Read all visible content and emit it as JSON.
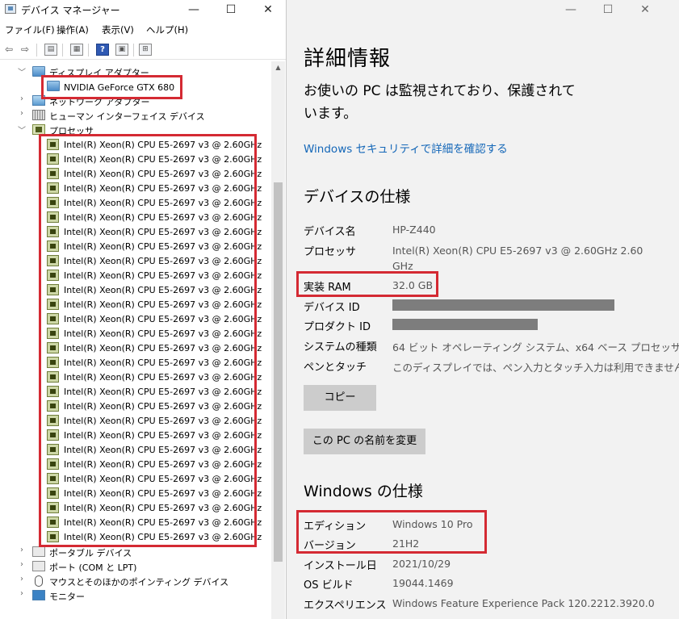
{
  "device_manager": {
    "title": "デバイス マネージャー",
    "window_controls": {
      "minimize": "—",
      "maximize": "☐",
      "close": "✕"
    },
    "menu": [
      "ファイル(F)",
      "操作(A)",
      "表示(V)",
      "ヘルプ(H)"
    ],
    "toolbar_help": "?",
    "tree": {
      "display_adapters": {
        "label": "ディスプレイ アダプター",
        "items": [
          "NVIDIA GeForce GTX 680"
        ]
      },
      "network_adapters": "ネットワーク アダプター",
      "hid": "ヒューマン インターフェイス デバイス",
      "processors": {
        "label": "プロセッサ",
        "items": [
          "Intel(R) Xeon(R) CPU E5-2697 v3 @ 2.60GHz",
          "Intel(R) Xeon(R) CPU E5-2697 v3 @ 2.60GHz",
          "Intel(R) Xeon(R) CPU E5-2697 v3 @ 2.60GHz",
          "Intel(R) Xeon(R) CPU E5-2697 v3 @ 2.60GHz",
          "Intel(R) Xeon(R) CPU E5-2697 v3 @ 2.60GHz",
          "Intel(R) Xeon(R) CPU E5-2697 v3 @ 2.60GHz",
          "Intel(R) Xeon(R) CPU E5-2697 v3 @ 2.60GHz",
          "Intel(R) Xeon(R) CPU E5-2697 v3 @ 2.60GHz",
          "Intel(R) Xeon(R) CPU E5-2697 v3 @ 2.60GHz",
          "Intel(R) Xeon(R) CPU E5-2697 v3 @ 2.60GHz",
          "Intel(R) Xeon(R) CPU E5-2697 v3 @ 2.60GHz",
          "Intel(R) Xeon(R) CPU E5-2697 v3 @ 2.60GHz",
          "Intel(R) Xeon(R) CPU E5-2697 v3 @ 2.60GHz",
          "Intel(R) Xeon(R) CPU E5-2697 v3 @ 2.60GHz",
          "Intel(R) Xeon(R) CPU E5-2697 v3 @ 2.60GHz",
          "Intel(R) Xeon(R) CPU E5-2697 v3 @ 2.60GHz",
          "Intel(R) Xeon(R) CPU E5-2697 v3 @ 2.60GHz",
          "Intel(R) Xeon(R) CPU E5-2697 v3 @ 2.60GHz",
          "Intel(R) Xeon(R) CPU E5-2697 v3 @ 2.60GHz",
          "Intel(R) Xeon(R) CPU E5-2697 v3 @ 2.60GHz",
          "Intel(R) Xeon(R) CPU E5-2697 v3 @ 2.60GHz",
          "Intel(R) Xeon(R) CPU E5-2697 v3 @ 2.60GHz",
          "Intel(R) Xeon(R) CPU E5-2697 v3 @ 2.60GHz",
          "Intel(R) Xeon(R) CPU E5-2697 v3 @ 2.60GHz",
          "Intel(R) Xeon(R) CPU E5-2697 v3 @ 2.60GHz",
          "Intel(R) Xeon(R) CPU E5-2697 v3 @ 2.60GHz",
          "Intel(R) Xeon(R) CPU E5-2697 v3 @ 2.60GHz",
          "Intel(R) Xeon(R) CPU E5-2697 v3 @ 2.60GHz"
        ]
      },
      "portable_devices": "ポータブル デバイス",
      "ports": "ポート (COM と LPT)",
      "mice": "マウスとそのほかのポインティング デバイス",
      "monitors": "モニター"
    }
  },
  "settings": {
    "window_controls": {
      "minimize": "—",
      "maximize": "☐",
      "close": "✕"
    },
    "title": "詳細情報",
    "notice": "お使いの PC は監視されており、保護されています。",
    "security_link": "Windows セキュリティで詳細を確認する",
    "device_spec": {
      "heading": "デバイスの仕様",
      "rows": [
        {
          "label": "デバイス名",
          "value": "HP-Z440"
        },
        {
          "label": "プロセッサ",
          "value": "Intel(R) Xeon(R) CPU E5-2697 v3 @ 2.60GHz   2.60 GHz"
        },
        {
          "label": "実装 RAM",
          "value": "32.0 GB"
        },
        {
          "label": "デバイス ID",
          "value": ""
        },
        {
          "label": "プロダクト ID",
          "value": ""
        },
        {
          "label": "システムの種類",
          "value": "64 ビット オペレーティング システム、x64 ベース プロセッサ"
        },
        {
          "label": "ペンとタッチ",
          "value": "このディスプレイでは、ペン入力とタッチ入力は利用できません"
        }
      ],
      "copy_button": "コピー",
      "rename_button": "この PC の名前を変更"
    },
    "windows_spec": {
      "heading": "Windows の仕様",
      "rows": [
        {
          "label": "エディション",
          "value": "Windows 10 Pro"
        },
        {
          "label": "バージョン",
          "value": "21H2"
        },
        {
          "label": "インストール日",
          "value": "2021/10/29"
        },
        {
          "label": "OS ビルド",
          "value": "19044.1469"
        },
        {
          "label": "エクスペリエンス",
          "value": "Windows Feature Experience Pack 120.2212.3920.0"
        }
      ]
    },
    "highlight_color": "#d42a33",
    "link_color": "#1467b8"
  }
}
